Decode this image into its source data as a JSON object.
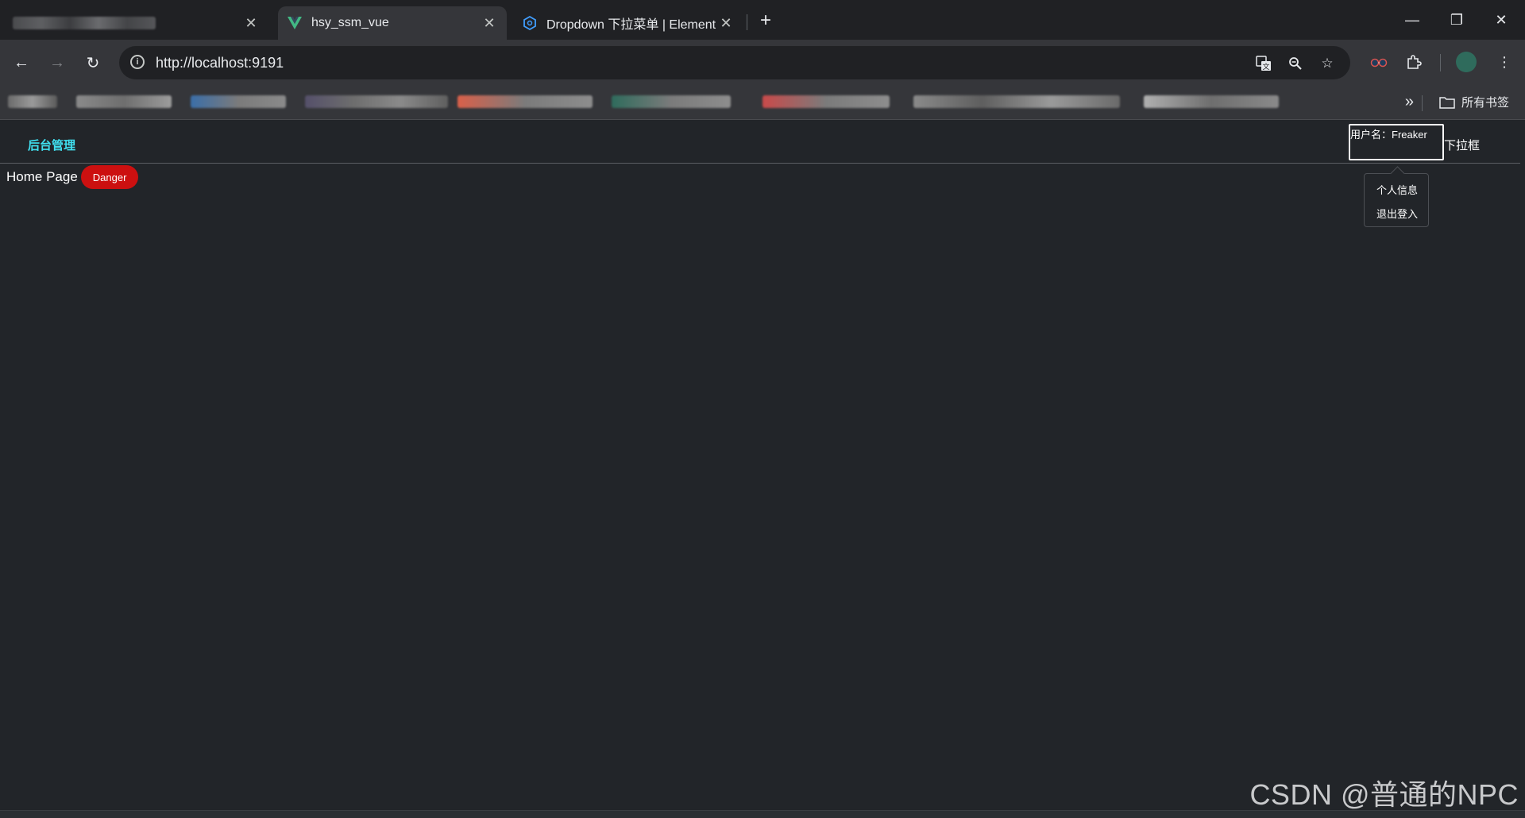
{
  "tabs": [
    {
      "title": "",
      "blurred": true
    },
    {
      "title": "hsy_ssm_vue",
      "active": true
    },
    {
      "title": "Dropdown 下拉菜单 | Element"
    }
  ],
  "address_bar": {
    "url": "http://localhost:9191"
  },
  "bookmarks": {
    "all_label": "所有书签"
  },
  "page": {
    "brand": "后台管理",
    "username": "用户名：Freaker",
    "dropdown_trigger": "下拉框",
    "home_text": "Home Page",
    "danger_label": "Danger",
    "dropdown_items": [
      "个人信息",
      "退出登入"
    ]
  },
  "watermark": "CSDN @普通的NPC",
  "colors": {
    "page_bg": "#222529",
    "brand": "#40e0f0",
    "danger": "#cc1010"
  }
}
